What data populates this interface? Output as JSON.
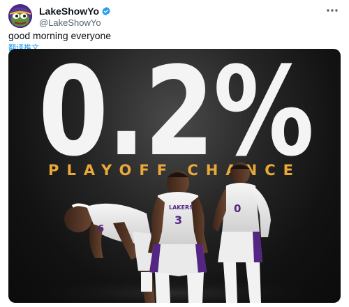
{
  "tweet": {
    "display_name": "LakeShowYo",
    "handle": "@LakeShowYo",
    "text": "good morning everyone",
    "translate_link": "翻译推文"
  },
  "media": {
    "stat": "0.2%",
    "subtitle": "PLAYOFF CHANCE",
    "jersey_numbers": {
      "left_player": "6",
      "center_player": "3",
      "right_player": "0"
    },
    "jersey_wordmark": "LAKERS"
  },
  "colors": {
    "accent_link": "#1d9bf0",
    "verified": "#1d9bf0",
    "subtitle_gold": "#e9a83a",
    "lakers_purple": "#552583",
    "lakers_gold": "#fdb927"
  }
}
